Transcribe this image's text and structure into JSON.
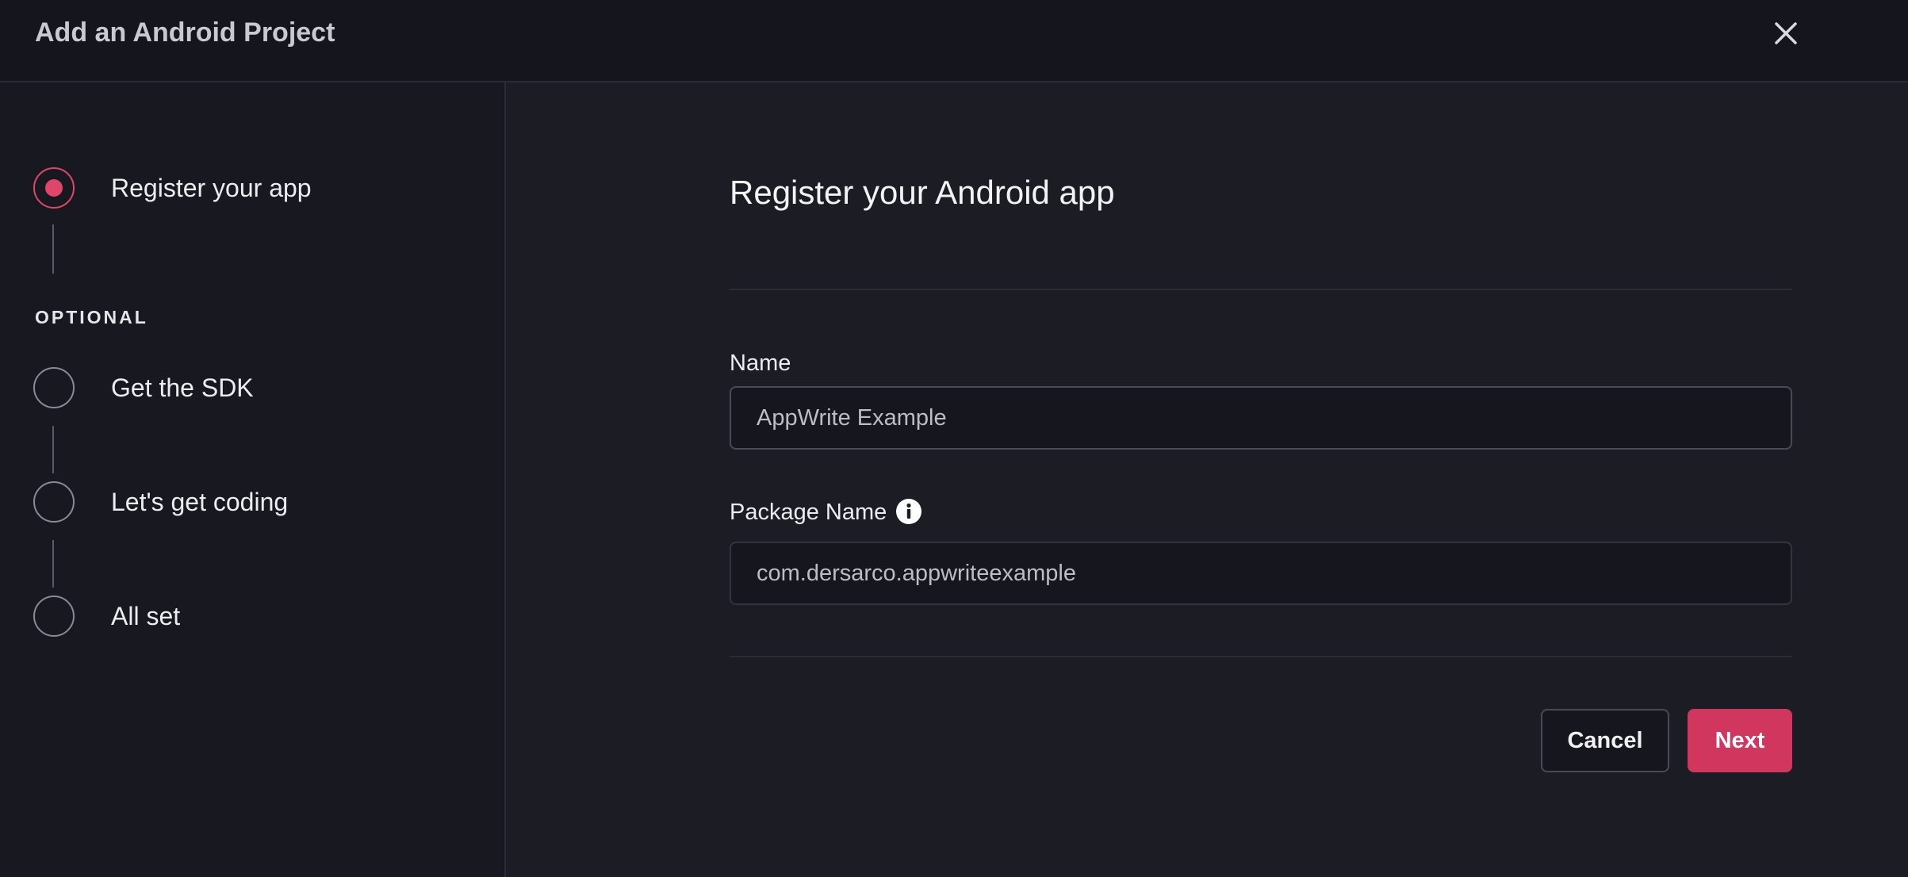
{
  "header": {
    "title": "Add an Android Project",
    "close_icon": "close-icon"
  },
  "sidebar": {
    "steps": [
      {
        "label": "Register your app",
        "state": "active"
      },
      {
        "label": "Get the SDK",
        "state": "inactive"
      },
      {
        "label": "Let's get coding",
        "state": "inactive"
      },
      {
        "label": "All set",
        "state": "inactive"
      }
    ],
    "optional_label": "OPTIONAL"
  },
  "main": {
    "title": "Register your Android app",
    "name_label": "Name",
    "name_value": "AppWrite Example",
    "package_label": "Package Name",
    "package_info_icon": "info-icon",
    "package_value": "com.dersarco.appwriteexample",
    "cancel_label": "Cancel",
    "next_label": "Next"
  },
  "colors": {
    "accent": "#d1365f",
    "background": "#1c1c25",
    "sidebar_background": "#181820",
    "header_background": "#15151e"
  }
}
